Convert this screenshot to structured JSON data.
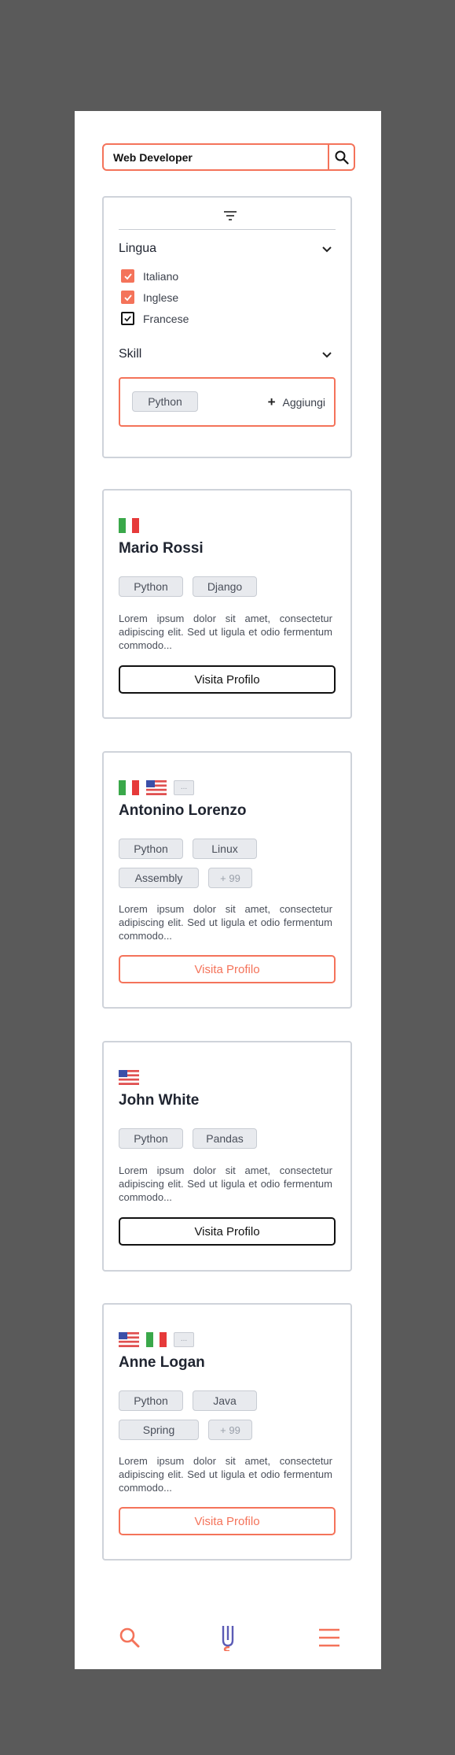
{
  "search": {
    "value": "Web Developer"
  },
  "filters": {
    "language_title": "Lingua",
    "languages": [
      {
        "label": "Italiano",
        "checked": true
      },
      {
        "label": "Inglese",
        "checked": true
      },
      {
        "label": "Francese",
        "checked": true
      }
    ],
    "skill_title": "Skill",
    "skills": [
      "Python"
    ],
    "add_label": "Aggiungi"
  },
  "profiles": [
    {
      "flags": [
        "italy-flag-icon"
      ],
      "name": "Mario Rossi",
      "tags": [
        "Python",
        "Django"
      ],
      "description": "Lorem ipsum dolor sit amet, consectetur adipiscing elit. Sed ut ligula et odio fermentum commodo...",
      "button": "Visita Profilo",
      "button_style": "dark"
    },
    {
      "flags": [
        "italy-flag-icon",
        "usa-flag-icon",
        "more"
      ],
      "more_label": "...",
      "name": "Antonino Lorenzo",
      "tags": [
        "Python",
        "Linux",
        "Assembly",
        "+ 99"
      ],
      "description": "Lorem ipsum dolor sit amet, consectetur adipiscing elit. Sed ut ligula et odio fermentum commodo...",
      "button": "Visita Profilo",
      "button_style": "orange"
    },
    {
      "flags": [
        "usa-flag-icon"
      ],
      "name": "John White",
      "tags": [
        "Python",
        "Pandas"
      ],
      "description": "Lorem ipsum dolor sit amet, consectetur adipiscing elit. Sed ut ligula et odio fermentum commodo...",
      "button": "Visita Profilo",
      "button_style": "dark"
    },
    {
      "flags": [
        "usa-flag-icon",
        "italy-flag-icon",
        "more"
      ],
      "more_label": "...",
      "name": "Anne Logan",
      "tags": [
        "Python",
        "Java",
        "Spring",
        "+ 99"
      ],
      "description": "Lorem ipsum dolor sit amet, consectetur adipiscing elit. Sed ut ligula et odio fermentum commodo...",
      "button": "Visita Profilo",
      "button_style": "orange"
    }
  ],
  "nav": {
    "icons": [
      "search-icon",
      "logo-icon",
      "menu-icon"
    ]
  },
  "colors": {
    "accent": "#f4735a",
    "logo": "#5b5bb5",
    "background": "#5a5a5a",
    "tag_bg": "#e8eaee"
  }
}
